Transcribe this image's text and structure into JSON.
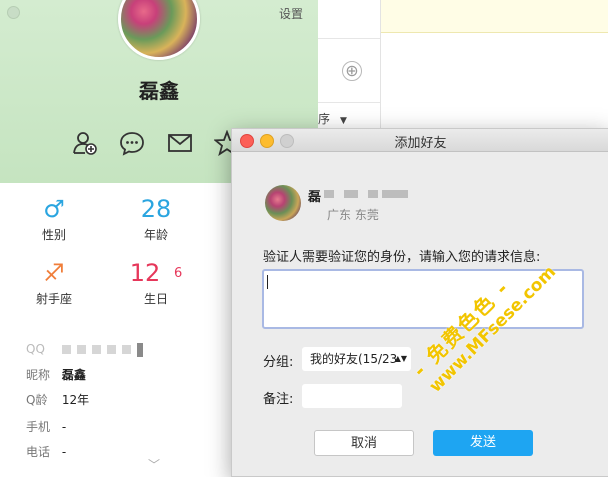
{
  "profile": {
    "settings_label": "设置",
    "nickname": "磊鑫",
    "actions": [
      {
        "icon": "add-friend-icon"
      },
      {
        "icon": "chat-bubble-icon"
      },
      {
        "icon": "mail-icon"
      },
      {
        "icon": "star-icon"
      }
    ],
    "stats": {
      "gender": {
        "icon": "male-symbol",
        "value": "♂",
        "label": "性别"
      },
      "age": {
        "value": "28",
        "label": "年龄"
      },
      "zodiac": {
        "icon": "sagittarius-symbol",
        "value": "♐",
        "label": "射手座"
      },
      "birthday": {
        "month": "12",
        "day": "6",
        "label": "生日"
      }
    },
    "info": {
      "qq_label": "QQ",
      "nickname_label": "昵称",
      "nickname_value": "磊鑫",
      "qage_label": "Q龄",
      "qage_value": "12年",
      "phone_label": "手机",
      "phone_value": "-",
      "tel_label": "电话",
      "tel_value": "-"
    },
    "colors": {
      "header_green": "#cfe9cb",
      "gender_blue": "#2aa5e0",
      "zodiac_orange": "#f07e3a",
      "birthday_red": "#e6375a"
    }
  },
  "background": {
    "sort_label": "序",
    "add_symbol": "⊕"
  },
  "dialog": {
    "title": "添加好友",
    "user_name": "磊",
    "user_location": "广东 东莞",
    "prompt": "验证人需要验证您的身份，请输入您的请求信息:",
    "request_value": "",
    "group_label": "分组:",
    "group_value": "我的好友(15/23",
    "remark_label": "备注:",
    "remark_value": "",
    "cancel_label": "取消",
    "send_label": "发送",
    "colors": {
      "send_button": "#1ea5f2",
      "input_focus": "#a9b9e4"
    }
  },
  "watermark": {
    "line1": "- 免费色色 -",
    "line2": "www.MFsese.com"
  }
}
